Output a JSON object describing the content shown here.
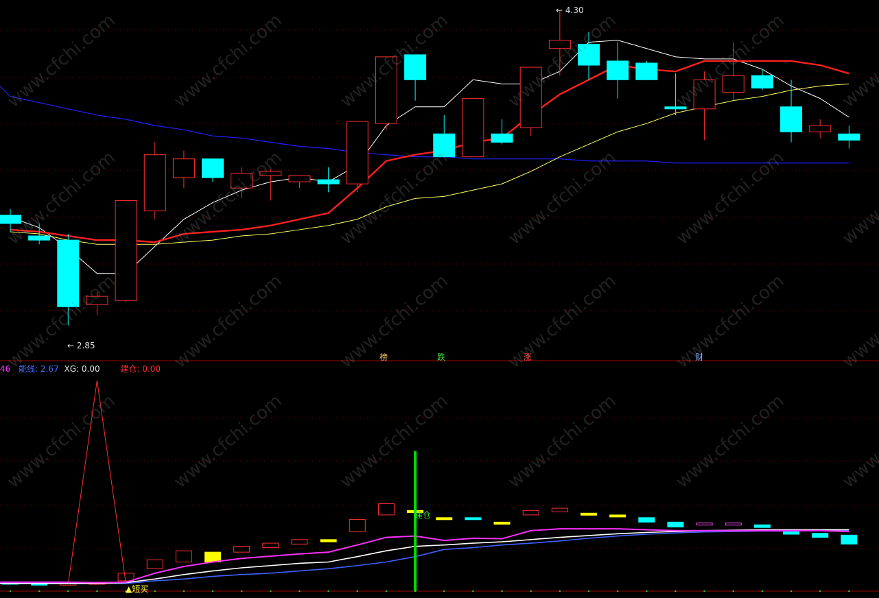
{
  "watermark": "www.cfchi.com",
  "price_labels": {
    "high": "4.30",
    "low": "2.85"
  },
  "markers": [
    {
      "text": "榜",
      "color": "#f0c060"
    },
    {
      "text": "跌",
      "color": "#40e040"
    },
    {
      "text": "涨",
      "color": "#ff4040"
    },
    {
      "text": "财",
      "color": "#80b0ff"
    }
  ],
  "indicator_header": {
    "first_value": "46",
    "energy_label": "能线:",
    "energy_value": "2.67",
    "xg_label": "XG:",
    "xg_value": "0.00",
    "build_label": "建仓:",
    "build_value": "0.00"
  },
  "signals": {
    "short_buy": "▲短买",
    "build": "建仓"
  },
  "colors": {
    "up": "#ff3030",
    "down": "#00ffff",
    "ma_short": "#ffffff",
    "ma_mid": "#ff2020",
    "ma_long": "#ffff60",
    "ma_year": "#2020ff",
    "energy": "#4060ff",
    "magenta": "#ff30ff",
    "grid": "#800000",
    "signal": "#00e000",
    "yellow": "#ffff00"
  },
  "chart_data": {
    "type": "candlestick",
    "ylim": [
      2.75,
      4.38
    ],
    "candles": [
      {
        "o": 3.38,
        "h": 3.41,
        "l": 3.3,
        "c": 3.34
      },
      {
        "o": 3.28,
        "h": 3.34,
        "l": 3.24,
        "c": 3.26
      },
      {
        "o": 3.26,
        "h": 3.29,
        "l": 2.85,
        "c": 2.94
      },
      {
        "o": 2.95,
        "h": 3.01,
        "l": 2.9,
        "c": 2.99
      },
      {
        "o": 2.97,
        "h": 3.45,
        "l": 2.96,
        "c": 3.45
      },
      {
        "o": 3.4,
        "h": 3.73,
        "l": 3.36,
        "c": 3.67
      },
      {
        "o": 3.56,
        "h": 3.69,
        "l": 3.51,
        "c": 3.65
      },
      {
        "o": 3.65,
        "h": 3.64,
        "l": 3.54,
        "c": 3.56
      },
      {
        "o": 3.51,
        "h": 3.61,
        "l": 3.46,
        "c": 3.58
      },
      {
        "o": 3.57,
        "h": 3.6,
        "l": 3.45,
        "c": 3.59
      },
      {
        "o": 3.54,
        "h": 3.56,
        "l": 3.51,
        "c": 3.57
      },
      {
        "o": 3.55,
        "h": 3.61,
        "l": 3.49,
        "c": 3.53
      },
      {
        "o": 3.53,
        "h": 3.83,
        "l": 3.49,
        "c": 3.83
      },
      {
        "o": 3.82,
        "h": 4.14,
        "l": 3.79,
        "c": 4.14
      },
      {
        "o": 4.15,
        "h": 4.15,
        "l": 3.93,
        "c": 4.03
      },
      {
        "o": 3.77,
        "h": 3.86,
        "l": 3.71,
        "c": 3.66
      },
      {
        "o": 3.66,
        "h": 3.9,
        "l": 3.66,
        "c": 3.94
      },
      {
        "o": 3.77,
        "h": 3.84,
        "l": 3.72,
        "c": 3.73
      },
      {
        "o": 3.8,
        "h": 4.09,
        "l": 3.76,
        "c": 4.09
      },
      {
        "o": 4.18,
        "h": 4.36,
        "l": 4.05,
        "c": 4.22
      },
      {
        "o": 4.2,
        "h": 4.26,
        "l": 4.03,
        "c": 4.1
      },
      {
        "o": 4.12,
        "h": 4.21,
        "l": 3.94,
        "c": 4.03
      },
      {
        "o": 4.11,
        "h": 4.12,
        "l": 4.06,
        "c": 4.03
      },
      {
        "o": 3.9,
        "h": 4.06,
        "l": 3.86,
        "c": 3.89
      },
      {
        "o": 3.89,
        "h": 4.07,
        "l": 3.74,
        "c": 4.03
      },
      {
        "o": 3.97,
        "h": 4.21,
        "l": 3.93,
        "c": 4.05
      },
      {
        "o": 4.05,
        "h": 4.08,
        "l": 3.98,
        "c": 3.99
      },
      {
        "o": 3.9,
        "h": 4.03,
        "l": 3.73,
        "c": 3.78
      },
      {
        "o": 3.78,
        "h": 3.84,
        "l": 3.75,
        "c": 3.81
      },
      {
        "o": 3.77,
        "h": 3.81,
        "l": 3.7,
        "c": 3.74
      }
    ],
    "ma_short": [
      3.37,
      3.32,
      3.22,
      3.1,
      3.1,
      3.23,
      3.36,
      3.44,
      3.5,
      3.54,
      3.56,
      3.54,
      3.62,
      3.81,
      3.9,
      3.9,
      4.03,
      4.01,
      4.01,
      4.07,
      4.21,
      4.22,
      4.18,
      4.14,
      4.13,
      4.13,
      4.08,
      4.0,
      3.94,
      3.85
    ],
    "ma_mid": [
      3.31,
      3.3,
      3.28,
      3.26,
      3.26,
      3.25,
      3.29,
      3.3,
      3.31,
      3.33,
      3.36,
      3.39,
      3.51,
      3.64,
      3.67,
      3.69,
      3.73,
      3.75,
      3.86,
      3.96,
      4.03,
      4.1,
      4.08,
      4.07,
      4.12,
      4.12,
      4.12,
      4.12,
      4.1,
      4.06
    ],
    "ma_long": [
      3.3,
      3.29,
      3.26,
      3.24,
      3.24,
      3.24,
      3.25,
      3.26,
      3.28,
      3.29,
      3.31,
      3.33,
      3.36,
      3.42,
      3.46,
      3.47,
      3.5,
      3.53,
      3.59,
      3.66,
      3.72,
      3.78,
      3.82,
      3.87,
      3.9,
      3.93,
      3.95,
      3.98,
      4.0,
      4.01
    ],
    "ma_year": [
      3.95,
      3.92,
      3.89,
      3.86,
      3.84,
      3.81,
      3.79,
      3.76,
      3.75,
      3.73,
      3.71,
      3.7,
      3.68,
      3.67,
      3.66,
      3.66,
      3.65,
      3.65,
      3.65,
      3.65,
      3.64,
      3.64,
      3.64,
      3.63,
      3.63,
      3.63,
      3.63,
      3.63,
      3.63,
      3.63
    ],
    "osc_lines": {
      "magenta": [
        0.05,
        0.05,
        0.05,
        0.04,
        0.05,
        0.25,
        0.4,
        0.5,
        0.58,
        0.63,
        0.68,
        0.72,
        0.88,
        1.05,
        1.08,
        0.98,
        1.03,
        1.02,
        1.2,
        1.24,
        1.24,
        1.24,
        1.22,
        1.2,
        1.2,
        1.2,
        1.2,
        1.2,
        1.2,
        1.18
      ],
      "white": [
        0.02,
        0.02,
        0.02,
        0.02,
        0.04,
        0.12,
        0.22,
        0.3,
        0.37,
        0.42,
        0.47,
        0.5,
        0.62,
        0.75,
        0.85,
        0.88,
        0.92,
        0.95,
        1.0,
        1.05,
        1.09,
        1.13,
        1.16,
        1.18,
        1.2,
        1.21,
        1.22,
        1.22,
        1.22,
        1.22
      ],
      "blue": [
        0.03,
        0.03,
        0.03,
        0.03,
        0.02,
        0.08,
        0.12,
        0.18,
        0.22,
        0.25,
        0.3,
        0.35,
        0.42,
        0.5,
        0.62,
        0.78,
        0.82,
        0.88,
        0.92,
        0.97,
        1.03,
        1.08,
        1.12,
        1.15,
        1.17,
        1.18,
        1.19,
        1.19,
        1.2,
        1.2
      ]
    },
    "osc_bars": [
      {
        "o": 0.05,
        "c": 0.02
      },
      {
        "o": 0.03,
        "c": 0.0
      },
      {
        "o": 0.0,
        "c": 0.03
      },
      {
        "o": 0.02,
        "c": 0.05
      },
      {
        "o": 0.08,
        "c": 0.25
      },
      {
        "o": 0.35,
        "c": 0.55
      },
      {
        "o": 0.5,
        "c": 0.75
      },
      {
        "o": 0.5,
        "c": 0.72
      },
      {
        "o": 0.72,
        "c": 0.85
      },
      {
        "o": 0.82,
        "c": 0.92
      },
      {
        "o": 0.9,
        "c": 1.0
      },
      {
        "o": 0.95,
        "c": 1.0
      },
      {
        "o": 1.18,
        "c": 1.45
      },
      {
        "o": 1.55,
        "c": 1.8
      },
      {
        "o": 1.65,
        "c": 1.6
      },
      {
        "o": 1.49,
        "c": 1.47
      },
      {
        "o": 1.49,
        "c": 1.47
      },
      {
        "o": 1.39,
        "c": 1.37
      },
      {
        "o": 1.55,
        "c": 1.65
      },
      {
        "o": 1.62,
        "c": 1.7
      },
      {
        "o": 1.59,
        "c": 1.55
      },
      {
        "o": 1.55,
        "c": 1.52
      },
      {
        "o": 1.49,
        "c": 1.39
      },
      {
        "o": 1.39,
        "c": 1.28
      },
      {
        "o": 1.33,
        "c": 1.37
      },
      {
        "o": 1.35,
        "c": 1.37
      },
      {
        "o": 1.33,
        "c": 1.27
      },
      {
        "o": 1.2,
        "c": 1.12
      },
      {
        "o": 1.14,
        "c": 1.05
      },
      {
        "o": 1.1,
        "c": 0.9
      }
    ],
    "osc_bar_colors": [
      "down",
      "down",
      "up",
      "up",
      "up",
      "up",
      "up",
      "yellow",
      "up",
      "up",
      "up",
      "yellow",
      "up",
      "up",
      "yellow",
      "yellow",
      "down",
      "yellow",
      "up",
      "up",
      "yellow",
      "yellow",
      "down",
      "down",
      "up",
      "up",
      "down",
      "down",
      "down",
      "down"
    ],
    "spike": {
      "index": 3,
      "value": 4.55
    },
    "signal_index": 14,
    "osc_ylim": [
      -0.15,
      4.7
    ]
  }
}
